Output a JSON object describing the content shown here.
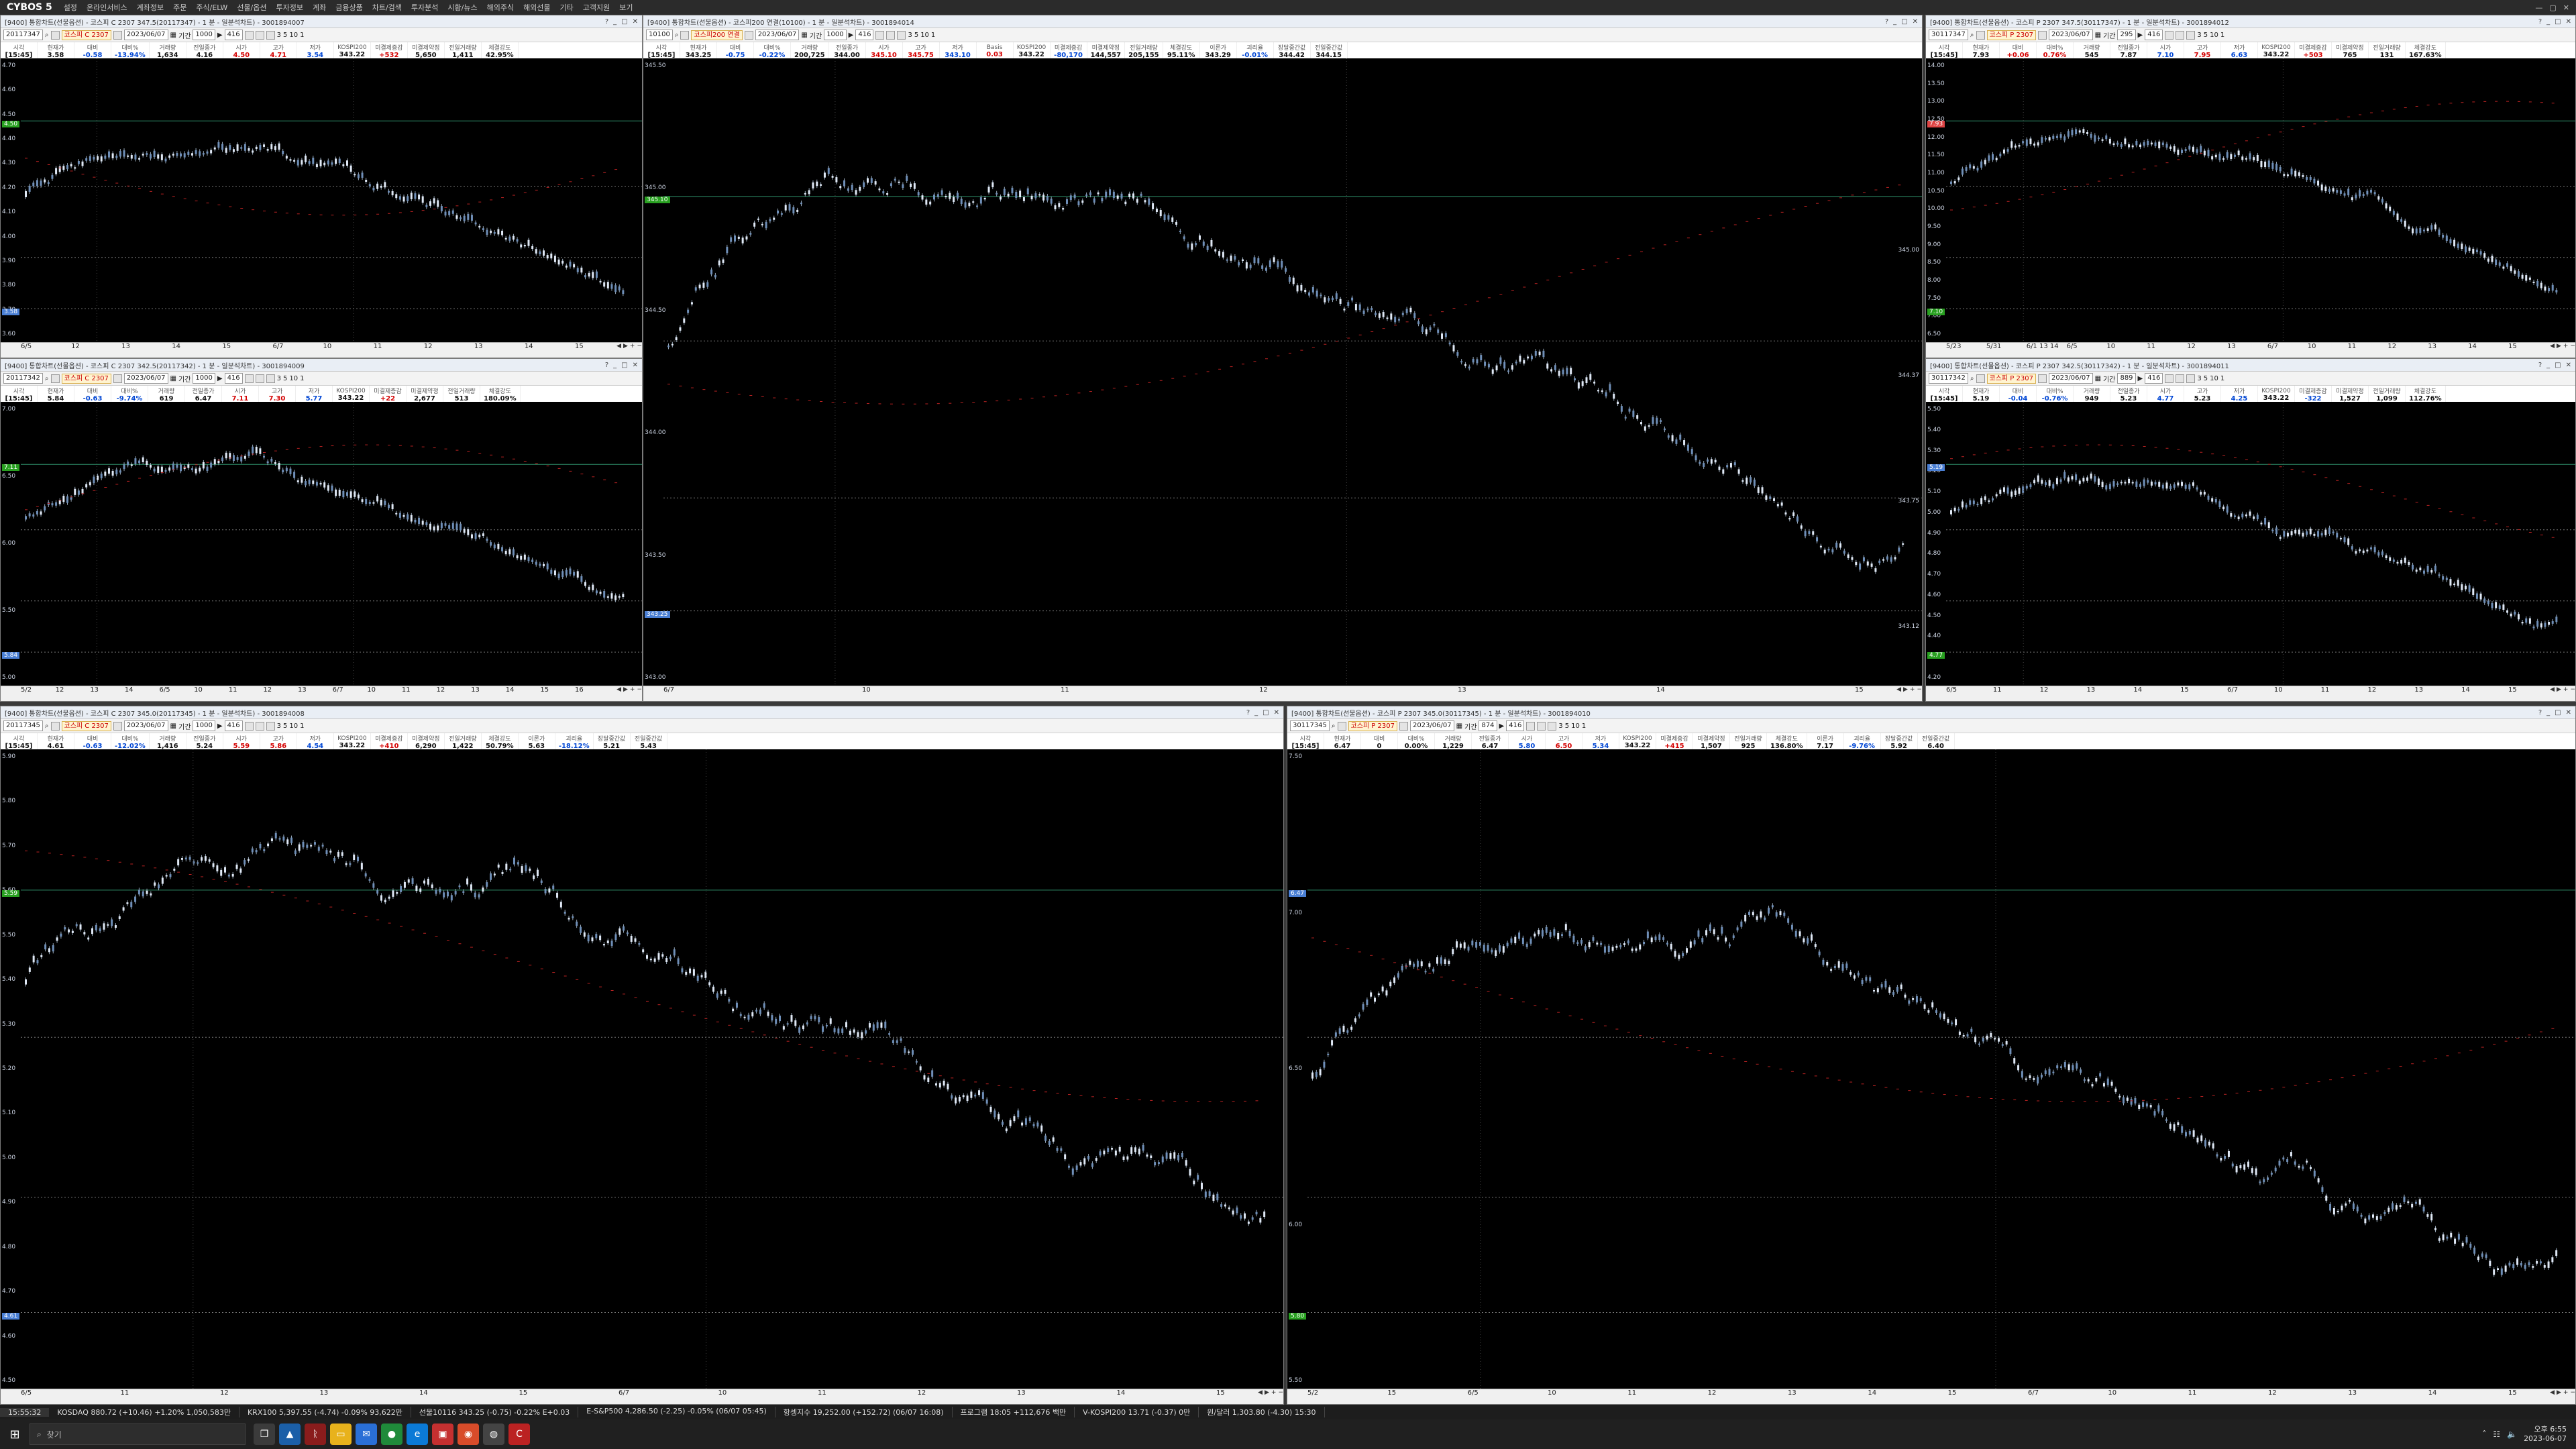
{
  "app": {
    "logo": "CYBOS 5",
    "menu": [
      "설정",
      "온라인서비스",
      "계좌정보",
      "주문",
      "주식/ELW",
      "선물/옵션",
      "투자정보",
      "계좌",
      "금융상품",
      "차트/검색",
      "투자분석",
      "시황/뉴스",
      "해외주식",
      "해외선물",
      "기타",
      "고객지원",
      "보기"
    ]
  },
  "windows": [
    {
      "id": "w1",
      "title": "[9400] 통합차트(선물옵션) - 코스피 C 2307 347.5(20117347) - 1 분 - 일분석차트) - 3001894007",
      "code": "20117347",
      "name": "코스피 C 2307",
      "date": "2023/06/07",
      "period": "1000",
      "num": "416",
      "quote": [
        [
          "시각",
          "[15:45]",
          ""
        ],
        [
          "현재가",
          "3.58",
          ""
        ],
        [
          "대비",
          "-0.58",
          "dn"
        ],
        [
          "대비%",
          "-13.94%",
          "dn"
        ],
        [
          "거래량",
          "1,634",
          ""
        ],
        [
          "전일종가",
          "4.16",
          ""
        ],
        [
          "시가",
          "4.50",
          "up"
        ],
        [
          "고가",
          "4.71",
          "up"
        ],
        [
          "저가",
          "3.54",
          "dn"
        ],
        [
          "KOSPI200",
          "343.22",
          ""
        ],
        [
          "미결제증감",
          "+532",
          "up"
        ],
        [
          "미결제약정",
          "5,650",
          ""
        ],
        [
          "전일거래량",
          "1,411",
          ""
        ],
        [
          "체결강도",
          "42.95%",
          ""
        ]
      ],
      "yticks": [
        "4.70",
        "4.60",
        "4.50",
        "4.40",
        "4.30",
        "4.20",
        "4.10",
        "4.00",
        "3.90",
        "3.80",
        "3.70",
        "3.60"
      ],
      "xticks": [
        "6/5",
        "12",
        "13",
        "14",
        "15",
        "6/7",
        "10",
        "11",
        "12",
        "13",
        "14",
        "15"
      ],
      "tags": [
        {
          "label": "4.50",
          "color": "#28a020"
        },
        {
          "label": "3.58",
          "color": "#4a7fd4"
        }
      ]
    },
    {
      "id": "w2",
      "title": "[9400] 통합차트(선물옵션) - 코스피200 연결(10100) - 1 분 - 일분석차트) - 3001894014",
      "code": "10100",
      "name": "코스피200 연결",
      "date": "2023/06/07",
      "period": "1000",
      "num": "416",
      "quote": [
        [
          "시각",
          "[15:45]",
          ""
        ],
        [
          "현재가",
          "343.25",
          ""
        ],
        [
          "대비",
          "-0.75",
          "dn"
        ],
        [
          "대비%",
          "-0.22%",
          "dn"
        ],
        [
          "거래량",
          "200,725",
          ""
        ],
        [
          "전일종가",
          "344.00",
          ""
        ],
        [
          "시가",
          "345.10",
          "up"
        ],
        [
          "고가",
          "345.75",
          "up"
        ],
        [
          "저가",
          "343.10",
          "dn"
        ],
        [
          "Basis",
          "0.03",
          "up"
        ],
        [
          "KOSPI200",
          "343.22",
          ""
        ],
        [
          "미결제증감",
          "-80,170",
          "dn"
        ],
        [
          "미결제약정",
          "144,557",
          ""
        ],
        [
          "전일거래량",
          "205,155",
          ""
        ],
        [
          "체결강도",
          "95.11%",
          ""
        ],
        [
          "이론가",
          "343.29",
          ""
        ],
        [
          "괴리율",
          "-0.01%",
          "dn"
        ],
        [
          "장달중간값",
          "344.42",
          ""
        ],
        [
          "전일중간값",
          "344.15",
          ""
        ]
      ],
      "yticks": [
        "345.50",
        "345.00",
        "344.50",
        "344.00",
        "343.50",
        "343.00"
      ],
      "xticks": [
        "6/7",
        "10",
        "11",
        "12",
        "13",
        "14",
        "15"
      ],
      "tags": [
        {
          "label": "345.10",
          "color": "#28a020"
        },
        {
          "label": "343.25",
          "color": "#4a7fd4"
        }
      ],
      "rlabels": [
        "345.00",
        "344.37",
        "343.75",
        "343.12"
      ]
    },
    {
      "id": "w3",
      "title": "[9400] 통합차트(선물옵션) - 코스피 P 2307 347.5(30117347) - 1 분 - 일분석차트) - 3001894012",
      "code": "30117347",
      "name": "코스피 P 2307",
      "date": "2023/06/07",
      "period": "295",
      "num": "416",
      "quote": [
        [
          "시각",
          "[15:45]",
          ""
        ],
        [
          "현재가",
          "7.93",
          ""
        ],
        [
          "대비",
          "+0.06",
          "up"
        ],
        [
          "대비%",
          "0.76%",
          "up"
        ],
        [
          "거래량",
          "545",
          ""
        ],
        [
          "전일종가",
          "7.87",
          ""
        ],
        [
          "시가",
          "7.10",
          "dn"
        ],
        [
          "고가",
          "7.95",
          "up"
        ],
        [
          "저가",
          "6.63",
          "dn"
        ],
        [
          "KOSPI200",
          "343.22",
          ""
        ],
        [
          "미결제증감",
          "+503",
          "up"
        ],
        [
          "미결제약정",
          "765",
          ""
        ],
        [
          "전일거래량",
          "131",
          ""
        ],
        [
          "체결강도",
          "167.63%",
          ""
        ]
      ],
      "yticks": [
        "14.00",
        "13.50",
        "13.00",
        "12.50",
        "12.00",
        "11.50",
        "11.00",
        "10.50",
        "10.00",
        "9.50",
        "9.00",
        "8.50",
        "8.00",
        "7.50",
        "7.00",
        "6.50"
      ],
      "xticks": [
        "5/23",
        "5/31",
        "6/1 13 14",
        "6/5",
        "10",
        "11",
        "12",
        "13",
        "6/7",
        "10",
        "11",
        "12",
        "13",
        "14",
        "15"
      ],
      "tags": [
        {
          "label": "7.93",
          "color": "#d44"
        },
        {
          "label": "7.10",
          "color": "#28a020"
        }
      ]
    },
    {
      "id": "w4",
      "title": "[9400] 통합차트(선물옵션) - 코스피 C 2307 342.5(20117342) - 1 분 - 일분석차트) - 3001894009",
      "code": "20117342",
      "name": "코스피 C 2307",
      "date": "2023/06/07",
      "period": "1000",
      "num": "416",
      "quote": [
        [
          "시각",
          "[15:45]",
          ""
        ],
        [
          "현재가",
          "5.84",
          ""
        ],
        [
          "대비",
          "-0.63",
          "dn"
        ],
        [
          "대비%",
          "-9.74%",
          "dn"
        ],
        [
          "거래량",
          "619",
          ""
        ],
        [
          "전일종가",
          "6.47",
          ""
        ],
        [
          "시가",
          "7.11",
          "up"
        ],
        [
          "고가",
          "7.30",
          "up"
        ],
        [
          "저가",
          "5.77",
          "dn"
        ],
        [
          "KOSPI200",
          "343.22",
          ""
        ],
        [
          "미결제증감",
          "+22",
          "up"
        ],
        [
          "미결제약정",
          "2,677",
          ""
        ],
        [
          "전일거래량",
          "513",
          ""
        ],
        [
          "체결강도",
          "180.09%",
          ""
        ]
      ],
      "yticks": [
        "7.00",
        "6.50",
        "6.00",
        "5.50",
        "5.00"
      ],
      "xticks": [
        "5/2",
        "12",
        "13",
        "14",
        "6/5",
        "10",
        "11",
        "12",
        "13",
        "6/7",
        "10",
        "11",
        "12",
        "13",
        "14",
        "15",
        "16"
      ],
      "tags": [
        {
          "label": "7.11",
          "color": "#28a020"
        },
        {
          "label": "5.84",
          "color": "#4a7fd4"
        }
      ]
    },
    {
      "id": "w5",
      "title": "[9400] 통합차트(선물옵션) - 코스피 P 2307 342.5(30117342) - 1 분 - 일분석차트) - 3001894011",
      "code": "30117342",
      "name": "코스피 P 2307",
      "date": "2023/06/07",
      "period": "889",
      "num": "416",
      "quote": [
        [
          "시각",
          "[15:45]",
          ""
        ],
        [
          "현재가",
          "5.19",
          ""
        ],
        [
          "대비",
          "-0.04",
          "dn"
        ],
        [
          "대비%",
          "-0.76%",
          "dn"
        ],
        [
          "거래량",
          "949",
          ""
        ],
        [
          "전일종가",
          "5.23",
          ""
        ],
        [
          "시가",
          "4.77",
          "dn"
        ],
        [
          "고가",
          "5.23",
          ""
        ],
        [
          "저가",
          "4.25",
          "dn"
        ],
        [
          "KOSPI200",
          "343.22",
          ""
        ],
        [
          "미결제증감",
          "-322",
          "dn"
        ],
        [
          "미결제약정",
          "1,527",
          ""
        ],
        [
          "전일거래량",
          "1,099",
          ""
        ],
        [
          "체결강도",
          "112.76%",
          ""
        ]
      ],
      "yticks": [
        "5.50",
        "5.40",
        "5.30",
        "5.20",
        "5.10",
        "5.00",
        "4.90",
        "4.80",
        "4.70",
        "4.60",
        "4.50",
        "4.40",
        "4.30",
        "4.20"
      ],
      "xticks": [
        "6/5",
        "11",
        "12",
        "13",
        "14",
        "15",
        "6/7",
        "10",
        "11",
        "12",
        "13",
        "14",
        "15"
      ],
      "tags": [
        {
          "label": "5.19",
          "color": "#4a7fd4"
        },
        {
          "label": "4.77",
          "color": "#28a020"
        }
      ]
    },
    {
      "id": "w6",
      "title": "[9400] 통합차트(선물옵션) - 코스피 C 2307 345.0(20117345) - 1 분 - 일분석차트) - 3001894008",
      "code": "20117345",
      "name": "코스피 C 2307",
      "date": "2023/06/07",
      "period": "1000",
      "num": "416",
      "quote": [
        [
          "시각",
          "[15:45]",
          ""
        ],
        [
          "현재가",
          "4.61",
          ""
        ],
        [
          "대비",
          "-0.63",
          "dn"
        ],
        [
          "대비%",
          "-12.02%",
          "dn"
        ],
        [
          "거래량",
          "1,416",
          ""
        ],
        [
          "전일종가",
          "5.24",
          ""
        ],
        [
          "시가",
          "5.59",
          "up"
        ],
        [
          "고가",
          "5.86",
          "up"
        ],
        [
          "저가",
          "4.54",
          "dn"
        ],
        [
          "KOSPI200",
          "343.22",
          ""
        ],
        [
          "미결제증감",
          "+410",
          "up"
        ],
        [
          "미결제약정",
          "6,290",
          ""
        ],
        [
          "전일거래량",
          "1,422",
          ""
        ],
        [
          "체결강도",
          "50.79%",
          ""
        ],
        [
          "이론가",
          "5.63",
          ""
        ],
        [
          "괴리율",
          "-18.12%",
          "dn"
        ],
        [
          "장달중간값",
          "5.21",
          ""
        ],
        [
          "전일중간값",
          "5.43",
          ""
        ]
      ],
      "yticks": [
        "5.90",
        "5.80",
        "5.70",
        "5.60",
        "5.50",
        "5.40",
        "5.30",
        "5.20",
        "5.10",
        "5.00",
        "4.90",
        "4.80",
        "4.70",
        "4.60",
        "4.50"
      ],
      "xticks": [
        "6/5",
        "11",
        "12",
        "13",
        "14",
        "15",
        "6/7",
        "10",
        "11",
        "12",
        "13",
        "14",
        "15"
      ],
      "tags": [
        {
          "label": "5.59",
          "color": "#28a020"
        },
        {
          "label": "4.61",
          "color": "#4a7fd4"
        }
      ]
    },
    {
      "id": "w7",
      "title": "[9400] 통합차트(선물옵션) - 코스피 P 2307 345.0(30117345) - 1 분 - 일분석차트) - 3001894010",
      "code": "30117345",
      "name": "코스피 P 2307",
      "date": "2023/06/07",
      "period": "874",
      "num": "416",
      "quote": [
        [
          "시각",
          "[15:45]",
          ""
        ],
        [
          "현재가",
          "6.47",
          ""
        ],
        [
          "대비",
          "0",
          ""
        ],
        [
          "대비%",
          "0.00%",
          ""
        ],
        [
          "거래량",
          "1,229",
          ""
        ],
        [
          "전일종가",
          "6.47",
          ""
        ],
        [
          "시가",
          "5.80",
          "dn"
        ],
        [
          "고가",
          "6.50",
          "up"
        ],
        [
          "저가",
          "5.34",
          "dn"
        ],
        [
          "KOSPI200",
          "343.22",
          ""
        ],
        [
          "미결제증감",
          "+415",
          "up"
        ],
        [
          "미결제약정",
          "1,507",
          ""
        ],
        [
          "전일거래량",
          "925",
          ""
        ],
        [
          "체결강도",
          "136.80%",
          ""
        ],
        [
          "이론가",
          "7.17",
          ""
        ],
        [
          "괴리율",
          "-9.76%",
          "dn"
        ],
        [
          "장달중간값",
          "5.92",
          ""
        ],
        [
          "전일중간값",
          "6.40",
          ""
        ]
      ],
      "yticks": [
        "7.50",
        "7.00",
        "6.50",
        "6.00",
        "5.50"
      ],
      "xticks": [
        "5/2",
        "15",
        "6/5",
        "10",
        "11",
        "12",
        "13",
        "14",
        "15",
        "6/7",
        "10",
        "11",
        "12",
        "13",
        "14",
        "15"
      ],
      "tags": [
        {
          "label": "6.47",
          "color": "#4a7fd4"
        },
        {
          "label": "5.80",
          "color": "#28a020"
        }
      ]
    }
  ],
  "status": {
    "time": "15:55:32",
    "items": [
      "KOSDAQ 880.72 (+10.46) +1.20% 1,050,583만",
      "KRX100 5,397.55 (-4.74) -0.09% 93,622만",
      "선물10116 343.25 (-0.75) -0.22% E+0.03",
      "E-S&P500 4,286.50 (-2.25) -0.05% (06/07 05:45)",
      "항셍지수 19,252.00 (+152.72) (06/07 16:08)",
      "프로그램 18:05 +112,676 백만",
      "V-KOSPI200 13.71 (-0.37) 0만",
      "원/달러 1,303.80 (-4.30) 15:30"
    ]
  },
  "taskbar": {
    "search_placeholder": "찾기",
    "time": "오후 6:55",
    "date": "2023-06-07"
  }
}
